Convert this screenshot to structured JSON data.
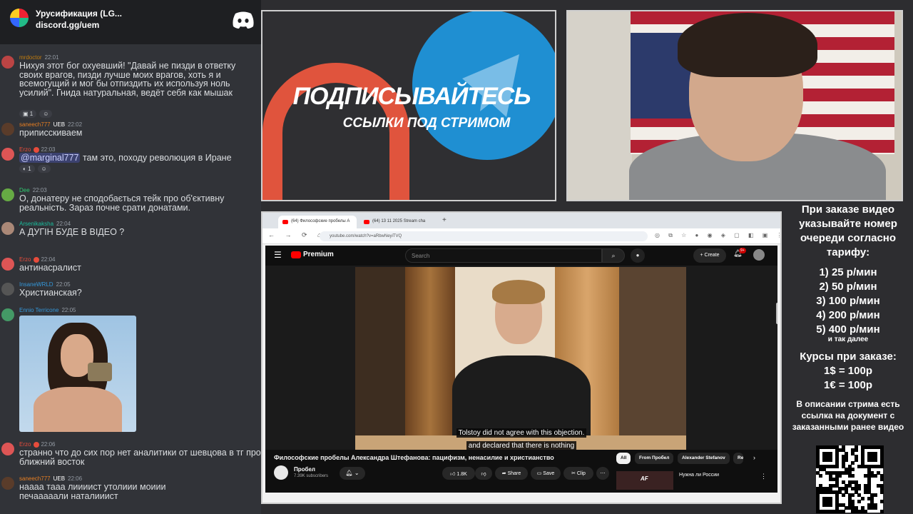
{
  "chat": {
    "server_name": "Урусификация (LG...",
    "server_invite": "discord.gg/uem",
    "messages": [
      {
        "author": "mrdoctor",
        "time": "22:01",
        "author_color": "#c27c0e",
        "text": "Нихуя этот бог охуевший! \"Давай не пизди в ответку своих врагов, пизди лучше моих врагов, хоть я и всемогущий и мог бы отпиздить их используя ноль усилий\". Гнида натуральная, ведёт себя как мышак",
        "reactions": [
          "1"
        ]
      },
      {
        "author": "saneech777",
        "time": "22:02",
        "badge": "UEB",
        "author_color": "#e67e22",
        "text": "приписскиваем"
      },
      {
        "author": "Erzo",
        "time": "22:03",
        "author_color": "#e74c3c",
        "mention": "@marginal777",
        "text": "там это, походу революция в Иране",
        "reactions": [
          "1"
        ]
      },
      {
        "author": "Dee",
        "time": "22:03",
        "author_color": "#2ecc71",
        "text": "О, донатеру не сподобається  тейк про об'єктивну реальність. Зараз почне срати донатами."
      },
      {
        "author": "Arsenikaksha",
        "time": "22:04",
        "author_color": "#1abc9c",
        "text": "А ДУГІН БУДЕ В ВІДЕО ?"
      },
      {
        "author": "Erzo",
        "time": "22:04",
        "author_color": "#e74c3c",
        "text": "антинасралист"
      },
      {
        "author": "InsaneWRLD",
        "time": "22:05",
        "author_color": "#3498db",
        "text": "Христианская?"
      },
      {
        "author": "Ennio Terricone",
        "time": "22:05",
        "author_color": "#3498db",
        "text": ""
      },
      {
        "author": "Erzo",
        "time": "22:06",
        "author_color": "#e74c3c",
        "text": "странно что до сих пор нет аналитики от шевцова в тг про ближний восток"
      },
      {
        "author": "saneech777",
        "time": "22:06",
        "badge": "UEB",
        "author_color": "#e67e22",
        "text": "наааа тааа лиииист утолиии моиии печааааали наталииист"
      }
    ]
  },
  "banner": {
    "title": "ПОДПИСЫВАЙТЕСЬ",
    "subtitle": "ССЫЛКИ ПОД СТРИМОМ"
  },
  "browser": {
    "tabs": [
      {
        "label": "(64) Философские пробелы А"
      },
      {
        "label": "(64) 13 11 2025 Stream cha"
      }
    ],
    "url": "youtube.com/watch?v=aRbwNeyiTVQ",
    "youtube": {
      "logo_text": "Premium",
      "search_placeholder": "Search",
      "create_label": "Create",
      "notifications": "9+",
      "subtitles": [
        "Tolstoy did not agree with this objection.",
        "and declared that there is nothing"
      ],
      "video_title": "Философские пробелы Александра Штефанова: пацифизм, ненасилие и христианство",
      "channel_name": "Пробел",
      "channel_subs": "7.39K subscribers",
      "like_count": "1.8K",
      "share_label": "Share",
      "save_label": "Save",
      "clip_label": "Clip",
      "filters": [
        "All",
        "From Пробел",
        "Alexander Stefanov",
        "Re"
      ],
      "rec_thumb_text": "AF",
      "rec_title": "Нужна ли России"
    }
  },
  "info": {
    "order_text": "При заказе видео указывайте номер очереди согласно тарифу:",
    "prices": [
      "1) 25 р/мин",
      "2) 50 р/мин",
      "3) 100 р/мин",
      "4) 200 р/мин",
      "5) 400 р/мин"
    ],
    "etc": "и так далее",
    "rates_title": "Курсы при заказе:",
    "rates": [
      "1$ = 100р",
      "1€ = 100р"
    ],
    "description": "В описании стрима есть ссылка на документ с заказанными ранее видео"
  }
}
